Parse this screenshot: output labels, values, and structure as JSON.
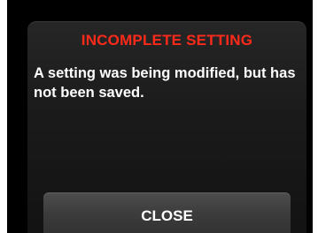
{
  "dialog": {
    "title": "INCOMPLETE SETTING",
    "message": "A setting was being modified, but has not been saved.",
    "close_label": "CLOSE"
  },
  "colors": {
    "title": "#ff2a1a",
    "message": "#ffffff",
    "background": "#000000",
    "button": "#3e3e3e"
  }
}
